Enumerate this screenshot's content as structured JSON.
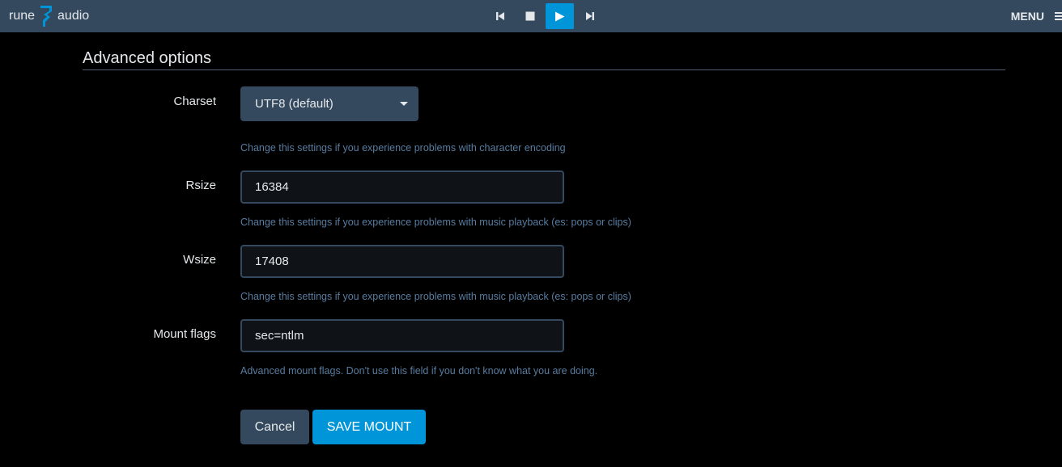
{
  "header": {
    "brand_left": "rune",
    "brand_right": "audio",
    "menu_label": "MENU",
    "controls": [
      {
        "name": "previous",
        "icon": "skip-previous-icon"
      },
      {
        "name": "stop",
        "icon": "stop-icon"
      },
      {
        "name": "play",
        "icon": "play-icon",
        "active": true
      },
      {
        "name": "next",
        "icon": "skip-next-icon"
      }
    ],
    "colors": {
      "bar": "#34495e",
      "accent": "#0095d8"
    }
  },
  "section": {
    "title": "Advanced options"
  },
  "form": {
    "charset": {
      "label": "Charset",
      "value": "UTF8 (default)",
      "help": "Change this settings if you experience problems with character encoding"
    },
    "rsize": {
      "label": "Rsize",
      "value": "16384",
      "help": "Change this settings if you experience problems with music playback (es: pops or clips)"
    },
    "wsize": {
      "label": "Wsize",
      "value": "17408",
      "help": "Change this settings if you experience problems with music playback (es: pops or clips)"
    },
    "mount_flags": {
      "label": "Mount flags",
      "value": "sec=ntlm",
      "help": "Advanced mount flags. Don't use this field if you don't know what you are doing."
    }
  },
  "actions": {
    "cancel_label": "Cancel",
    "save_label": "SAVE MOUNT"
  }
}
